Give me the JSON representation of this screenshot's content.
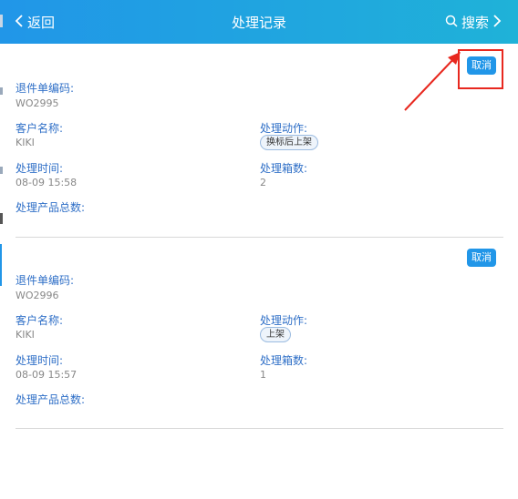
{
  "header": {
    "back_label": "返回",
    "title": "处理记录",
    "search_label": "搜索"
  },
  "records": [
    {
      "cancel_label": "取消",
      "return_no_label": "退件单编码:",
      "return_no": "WO2995",
      "customer_label": "客户名称:",
      "customer": "KIKI",
      "action_label": "处理动作:",
      "action": "换标后上架",
      "time_label": "处理时间:",
      "time": "08-09 15:58",
      "boxes_label": "处理箱数:",
      "boxes": "2",
      "total_label": "处理产品总数:"
    },
    {
      "cancel_label": "取消",
      "return_no_label": "退件单编码:",
      "return_no": "WO2996",
      "customer_label": "客户名称:",
      "customer": "KIKI",
      "action_label": "处理动作:",
      "action": "上架",
      "time_label": "处理时间:",
      "time": "08-09 15:57",
      "boxes_label": "处理箱数:",
      "boxes": "1",
      "total_label": "处理产品总数:"
    }
  ],
  "colors": {
    "header_start": "#2196e8",
    "header_end": "#1fb2d8",
    "label": "#2f6fc7",
    "button": "#2196e8",
    "highlight": "#e8281f"
  }
}
